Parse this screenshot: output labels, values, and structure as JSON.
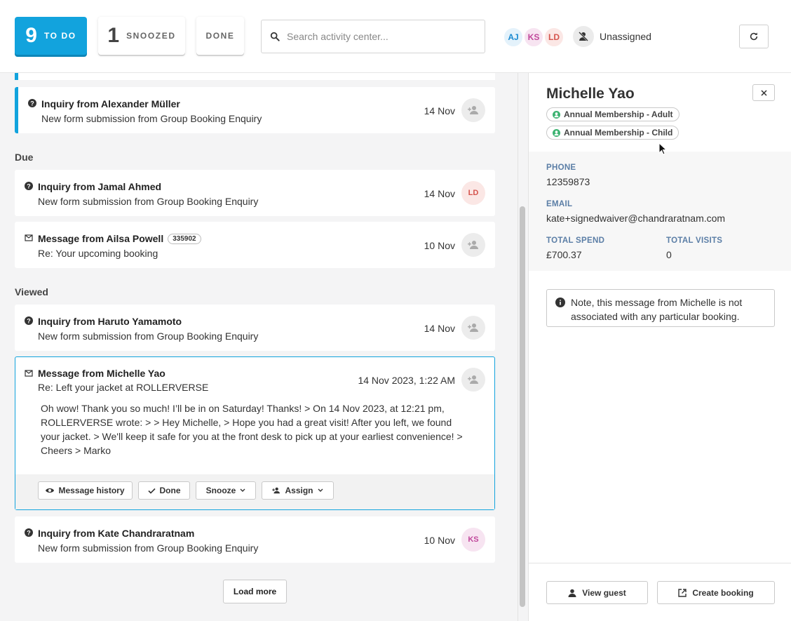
{
  "tabs": [
    {
      "count": "9",
      "label": "TO DO"
    },
    {
      "count": "1",
      "label": "SNOOZED"
    },
    {
      "label": "DONE"
    }
  ],
  "search": {
    "placeholder": "Search activity center..."
  },
  "assignees": [
    {
      "initials": "AJ",
      "color": "#1a8ad1",
      "bg": "#e4f2fb"
    },
    {
      "initials": "KS",
      "color": "#c0479b",
      "bg": "#f7e4f1"
    },
    {
      "initials": "LD",
      "color": "#d5544d",
      "bg": "#fbe7e5"
    }
  ],
  "unassigned_label": "Unassigned",
  "accent_color": "#12a3dd",
  "sections": {
    "due": "Due",
    "viewed": "Viewed"
  },
  "items": [
    {
      "title": "Inquiry from Alexander Müller",
      "subtitle": "New form submission from Group Booking Enquiry",
      "date": "14 Nov",
      "icon": "question-icon"
    },
    {
      "title": "Inquiry from Jamal Ahmed",
      "subtitle": "New form submission from Group Booking Enquiry",
      "date": "14 Nov",
      "icon": "question-icon",
      "assignee": "LD"
    },
    {
      "title": "Message from Ailsa Powell",
      "tag": "335902",
      "subtitle": "Re: Your upcoming booking",
      "date": "10 Nov",
      "icon": "envelope-icon"
    },
    {
      "title": "Inquiry from Haruto Yamamoto",
      "subtitle": "New form submission from Group Booking Enquiry",
      "date": "14 Nov",
      "icon": "question-icon"
    },
    {
      "title": "Inquiry from Kate Chandraratnam",
      "subtitle": "New form submission from Group Booking Enquiry",
      "date": "10 Nov",
      "icon": "question-icon",
      "assignee": "KS"
    }
  ],
  "expanded": {
    "title": "Message from Michelle Yao",
    "subtitle": "Re: Left your jacket at ROLLERVERSE",
    "date": "14 Nov 2023, 1:22 AM",
    "body": "Oh wow! Thank you so much! I’ll be in on Saturday! Thanks! > On 14 Nov 2023, at 12:21 pm, ROLLERVERSE wrote: > > Hey Michelle, > Hope you had a great visit! After you left, we found your jacket. > We'll keep it safe for you at the front desk to pick up at your earliest convenience! > Cheers > Marko",
    "actions": {
      "history": "Message history",
      "done": "Done",
      "snooze": "Snooze",
      "assign": "Assign"
    }
  },
  "load_more": "Load more",
  "guest": {
    "name": "Michelle Yao",
    "memberships": [
      "Annual Membership - Adult",
      "Annual Membership - Child"
    ],
    "phone_label": "PHONE",
    "phone": "12359873",
    "email_label": "EMAIL",
    "email": "kate+signedwaiver@chandraratnam.com",
    "spend_label": "TOTAL SPEND",
    "spend": "£700.37",
    "visits_label": "TOTAL VISITS",
    "visits": "0",
    "note": "Note, this message from Michelle is not associated with any particular booking.",
    "view_guest": "View guest",
    "create_booking": "Create booking"
  }
}
